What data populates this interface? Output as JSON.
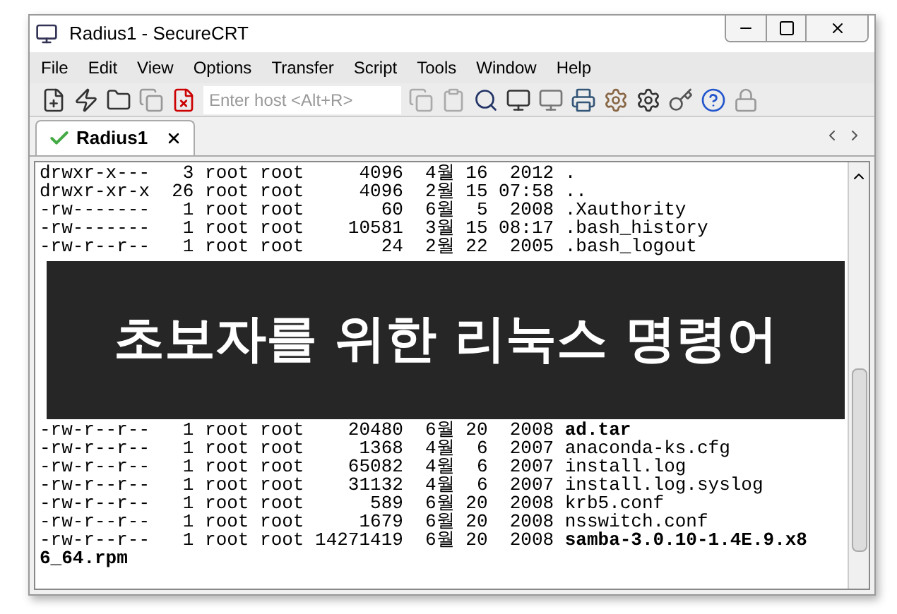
{
  "window": {
    "title": "Radius1 - SecureCRT"
  },
  "menu": [
    "File",
    "Edit",
    "View",
    "Options",
    "Transfer",
    "Script",
    "Tools",
    "Window",
    "Help"
  ],
  "toolbar": {
    "host_field": {
      "placeholder": "Enter host <Alt+R>"
    }
  },
  "tabs": [
    {
      "label": "Radius1",
      "selected": true,
      "connected": true
    }
  ],
  "terminal": {
    "lines": [
      {
        "kind": "text",
        "text": "drwxr-x---   3 root root     4096  4월 16  2012 ."
      },
      {
        "kind": "text",
        "text": "drwxr-xr-x  26 root root     4096  2월 15 07:58 .."
      },
      {
        "kind": "text",
        "text": "-rw-------   1 root root       60  6월  5  2008 .Xauthority"
      },
      {
        "kind": "text",
        "text": "-rw-------   1 root root    10581  3월 15 08:17 .bash_history"
      },
      {
        "kind": "text",
        "text": "-rw-r--r--   1 root root       24  2월 22  2005 .bash_logout"
      },
      {
        "kind": "obscured"
      },
      {
        "kind": "obscured"
      },
      {
        "kind": "obscured"
      },
      {
        "kind": "obscured"
      },
      {
        "kind": "obscured"
      },
      {
        "kind": "obscured"
      },
      {
        "kind": "obscured"
      },
      {
        "kind": "obscured"
      },
      {
        "kind": "obscured"
      },
      {
        "kind": "text",
        "text": "-rw-r--r--   1 root root    20480  6월 20  2008 **ad.tar**"
      },
      {
        "kind": "text",
        "text": "-rw-r--r--   1 root root     1368  4월  6  2007 anaconda-ks.cfg"
      },
      {
        "kind": "text",
        "text": "-rw-r--r--   1 root root    65082  4월  6  2007 install.log"
      },
      {
        "kind": "text",
        "text": "-rw-r--r--   1 root root    31132  4월  6  2007 install.log.syslog"
      },
      {
        "kind": "text",
        "text": "-rw-r--r--   1 root root      589  6월 20  2008 krb5.conf"
      },
      {
        "kind": "text",
        "text": "-rw-r--r--   1 root root     1679  6월 20  2008 nsswitch.conf"
      },
      {
        "kind": "text",
        "text": "-rw-r--r--   1 root root 14271419  6월 20  2008 **samba-3.0.10-1.4E.9.x8**"
      },
      {
        "kind": "bold",
        "text": "6_64.rpm"
      }
    ]
  },
  "banner": {
    "title": "초보자를 위한 리눅스 명령어"
  }
}
